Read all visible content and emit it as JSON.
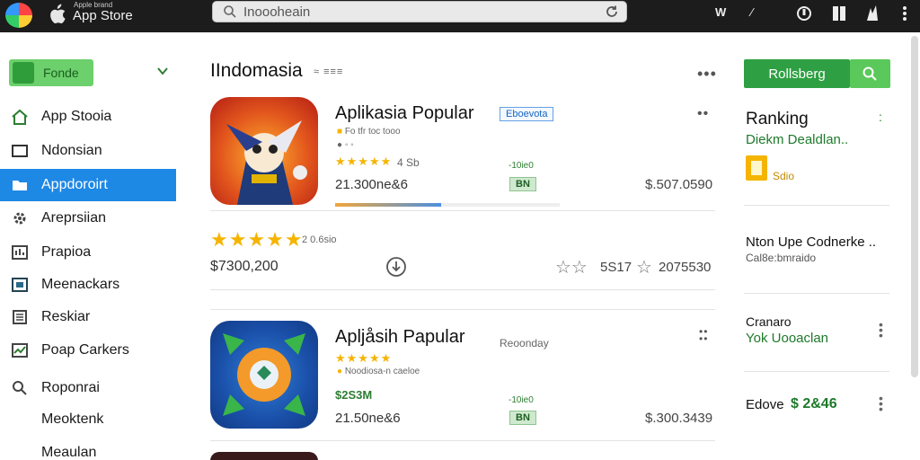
{
  "topbar": {
    "brand_small": "Apple brand",
    "brand": "App Store",
    "search_value": "Inoooheain",
    "right_label": "W",
    "right_arrow": "⁄"
  },
  "sidebar": {
    "top_button": "Fonde",
    "items": [
      {
        "label": "App Stooia",
        "icon": "home-icon"
      },
      {
        "label": "Ndonsian",
        "icon": "window-icon"
      },
      {
        "label": "Appdoroirt",
        "icon": "folder-icon",
        "active": true
      },
      {
        "label": "Areprsiian",
        "icon": "gear-icon"
      },
      {
        "label": "Prapioa",
        "icon": "chart-icon"
      },
      {
        "label": "Meenackars",
        "icon": "image-icon"
      },
      {
        "label": "Reskiar",
        "icon": "list-icon"
      },
      {
        "label": "Poap Carkers",
        "icon": "graph-icon"
      },
      {
        "label": "Roponrai",
        "icon": "search-icon"
      },
      {
        "label": "Meoktenk",
        "icon": ""
      },
      {
        "label": "Meaulan",
        "icon": ""
      }
    ]
  },
  "main": {
    "title": "IIndomasia",
    "title_sub": "≈ ≡≡≡",
    "apps": [
      {
        "title": "Aplikasia Popular",
        "badge": "Eboevota",
        "small_line": "Fo tfr toc tooo",
        "stars": "★★★★★",
        "rating_text": "4 Sb",
        "downloads": "21.300ne&6",
        "small_green": "-10ie0",
        "chip": "BN",
        "price": "$.507.0590",
        "progress": 0.47
      },
      {
        "title": "Apljåsih Papular",
        "badge": "Reoonday",
        "small_line": "Noodiosa-n caeloe",
        "stars": "★★★★★",
        "rating_text": "",
        "price_green": "$2S3M",
        "downloads": "21.50ne&6",
        "small_green": "-10ie0",
        "chip": "BN",
        "price": "$.300.3439"
      }
    ],
    "review": {
      "stars": "★★★★★",
      "stars_label": "2 0.6sio",
      "amount_left": "$7300,200",
      "empty_stars": "☆☆",
      "mid_num": "5S17",
      "amount_right": "2075530"
    }
  },
  "right_panel": {
    "button": "Rollsberg",
    "ranking_title": "Ranking",
    "ranking_sub": "Diekm Dealdlan..",
    "ranking_small": "Sdio",
    "row2_title": "Nton Upe Codnerke ..",
    "row2_sub": "Cal8e:bmraido",
    "row3_title": "Cranaro",
    "row3_sub": "Yok Uooaclan",
    "row4_label": "Edove",
    "row4_price": "$ 2&46"
  },
  "colors": {
    "accent_green": "#2ea043",
    "active_blue": "#1e88e5",
    "star_gold": "#f5b400"
  }
}
